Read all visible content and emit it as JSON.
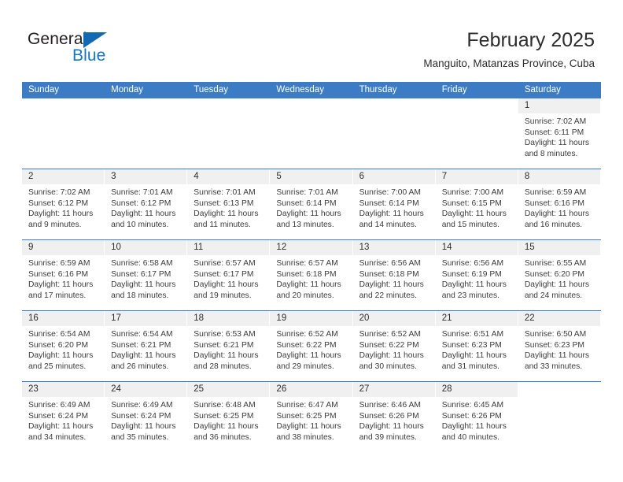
{
  "logo": {
    "text_primary": "General",
    "text_secondary": "Blue",
    "triangle_color": "#1268b3",
    "secondary_color": "#1577c4"
  },
  "header": {
    "title": "February 2025",
    "subtitle": "Manguito, Matanzas Province, Cuba"
  },
  "theme": {
    "header_row_bg": "#3b7cc4",
    "header_row_text": "#ffffff",
    "daynum_band_bg": "#f0f0f0",
    "row_divider": "#3b7cc4"
  },
  "weekdays": [
    "Sunday",
    "Monday",
    "Tuesday",
    "Wednesday",
    "Thursday",
    "Friday",
    "Saturday"
  ],
  "weeks": [
    [
      {
        "day": "",
        "lines": []
      },
      {
        "day": "",
        "lines": []
      },
      {
        "day": "",
        "lines": []
      },
      {
        "day": "",
        "lines": []
      },
      {
        "day": "",
        "lines": []
      },
      {
        "day": "",
        "lines": []
      },
      {
        "day": "1",
        "lines": [
          "Sunrise: 7:02 AM",
          "Sunset: 6:11 PM",
          "Daylight: 11 hours",
          "and 8 minutes."
        ]
      }
    ],
    [
      {
        "day": "2",
        "lines": [
          "Sunrise: 7:02 AM",
          "Sunset: 6:12 PM",
          "Daylight: 11 hours",
          "and 9 minutes."
        ]
      },
      {
        "day": "3",
        "lines": [
          "Sunrise: 7:01 AM",
          "Sunset: 6:12 PM",
          "Daylight: 11 hours",
          "and 10 minutes."
        ]
      },
      {
        "day": "4",
        "lines": [
          "Sunrise: 7:01 AM",
          "Sunset: 6:13 PM",
          "Daylight: 11 hours",
          "and 11 minutes."
        ]
      },
      {
        "day": "5",
        "lines": [
          "Sunrise: 7:01 AM",
          "Sunset: 6:14 PM",
          "Daylight: 11 hours",
          "and 13 minutes."
        ]
      },
      {
        "day": "6",
        "lines": [
          "Sunrise: 7:00 AM",
          "Sunset: 6:14 PM",
          "Daylight: 11 hours",
          "and 14 minutes."
        ]
      },
      {
        "day": "7",
        "lines": [
          "Sunrise: 7:00 AM",
          "Sunset: 6:15 PM",
          "Daylight: 11 hours",
          "and 15 minutes."
        ]
      },
      {
        "day": "8",
        "lines": [
          "Sunrise: 6:59 AM",
          "Sunset: 6:16 PM",
          "Daylight: 11 hours",
          "and 16 minutes."
        ]
      }
    ],
    [
      {
        "day": "9",
        "lines": [
          "Sunrise: 6:59 AM",
          "Sunset: 6:16 PM",
          "Daylight: 11 hours",
          "and 17 minutes."
        ]
      },
      {
        "day": "10",
        "lines": [
          "Sunrise: 6:58 AM",
          "Sunset: 6:17 PM",
          "Daylight: 11 hours",
          "and 18 minutes."
        ]
      },
      {
        "day": "11",
        "lines": [
          "Sunrise: 6:57 AM",
          "Sunset: 6:17 PM",
          "Daylight: 11 hours",
          "and 19 minutes."
        ]
      },
      {
        "day": "12",
        "lines": [
          "Sunrise: 6:57 AM",
          "Sunset: 6:18 PM",
          "Daylight: 11 hours",
          "and 20 minutes."
        ]
      },
      {
        "day": "13",
        "lines": [
          "Sunrise: 6:56 AM",
          "Sunset: 6:18 PM",
          "Daylight: 11 hours",
          "and 22 minutes."
        ]
      },
      {
        "day": "14",
        "lines": [
          "Sunrise: 6:56 AM",
          "Sunset: 6:19 PM",
          "Daylight: 11 hours",
          "and 23 minutes."
        ]
      },
      {
        "day": "15",
        "lines": [
          "Sunrise: 6:55 AM",
          "Sunset: 6:20 PM",
          "Daylight: 11 hours",
          "and 24 minutes."
        ]
      }
    ],
    [
      {
        "day": "16",
        "lines": [
          "Sunrise: 6:54 AM",
          "Sunset: 6:20 PM",
          "Daylight: 11 hours",
          "and 25 minutes."
        ]
      },
      {
        "day": "17",
        "lines": [
          "Sunrise: 6:54 AM",
          "Sunset: 6:21 PM",
          "Daylight: 11 hours",
          "and 26 minutes."
        ]
      },
      {
        "day": "18",
        "lines": [
          "Sunrise: 6:53 AM",
          "Sunset: 6:21 PM",
          "Daylight: 11 hours",
          "and 28 minutes."
        ]
      },
      {
        "day": "19",
        "lines": [
          "Sunrise: 6:52 AM",
          "Sunset: 6:22 PM",
          "Daylight: 11 hours",
          "and 29 minutes."
        ]
      },
      {
        "day": "20",
        "lines": [
          "Sunrise: 6:52 AM",
          "Sunset: 6:22 PM",
          "Daylight: 11 hours",
          "and 30 minutes."
        ]
      },
      {
        "day": "21",
        "lines": [
          "Sunrise: 6:51 AM",
          "Sunset: 6:23 PM",
          "Daylight: 11 hours",
          "and 31 minutes."
        ]
      },
      {
        "day": "22",
        "lines": [
          "Sunrise: 6:50 AM",
          "Sunset: 6:23 PM",
          "Daylight: 11 hours",
          "and 33 minutes."
        ]
      }
    ],
    [
      {
        "day": "23",
        "lines": [
          "Sunrise: 6:49 AM",
          "Sunset: 6:24 PM",
          "Daylight: 11 hours",
          "and 34 minutes."
        ]
      },
      {
        "day": "24",
        "lines": [
          "Sunrise: 6:49 AM",
          "Sunset: 6:24 PM",
          "Daylight: 11 hours",
          "and 35 minutes."
        ]
      },
      {
        "day": "25",
        "lines": [
          "Sunrise: 6:48 AM",
          "Sunset: 6:25 PM",
          "Daylight: 11 hours",
          "and 36 minutes."
        ]
      },
      {
        "day": "26",
        "lines": [
          "Sunrise: 6:47 AM",
          "Sunset: 6:25 PM",
          "Daylight: 11 hours",
          "and 38 minutes."
        ]
      },
      {
        "day": "27",
        "lines": [
          "Sunrise: 6:46 AM",
          "Sunset: 6:26 PM",
          "Daylight: 11 hours",
          "and 39 minutes."
        ]
      },
      {
        "day": "28",
        "lines": [
          "Sunrise: 6:45 AM",
          "Sunset: 6:26 PM",
          "Daylight: 11 hours",
          "and 40 minutes."
        ]
      },
      {
        "day": "",
        "lines": []
      }
    ]
  ]
}
